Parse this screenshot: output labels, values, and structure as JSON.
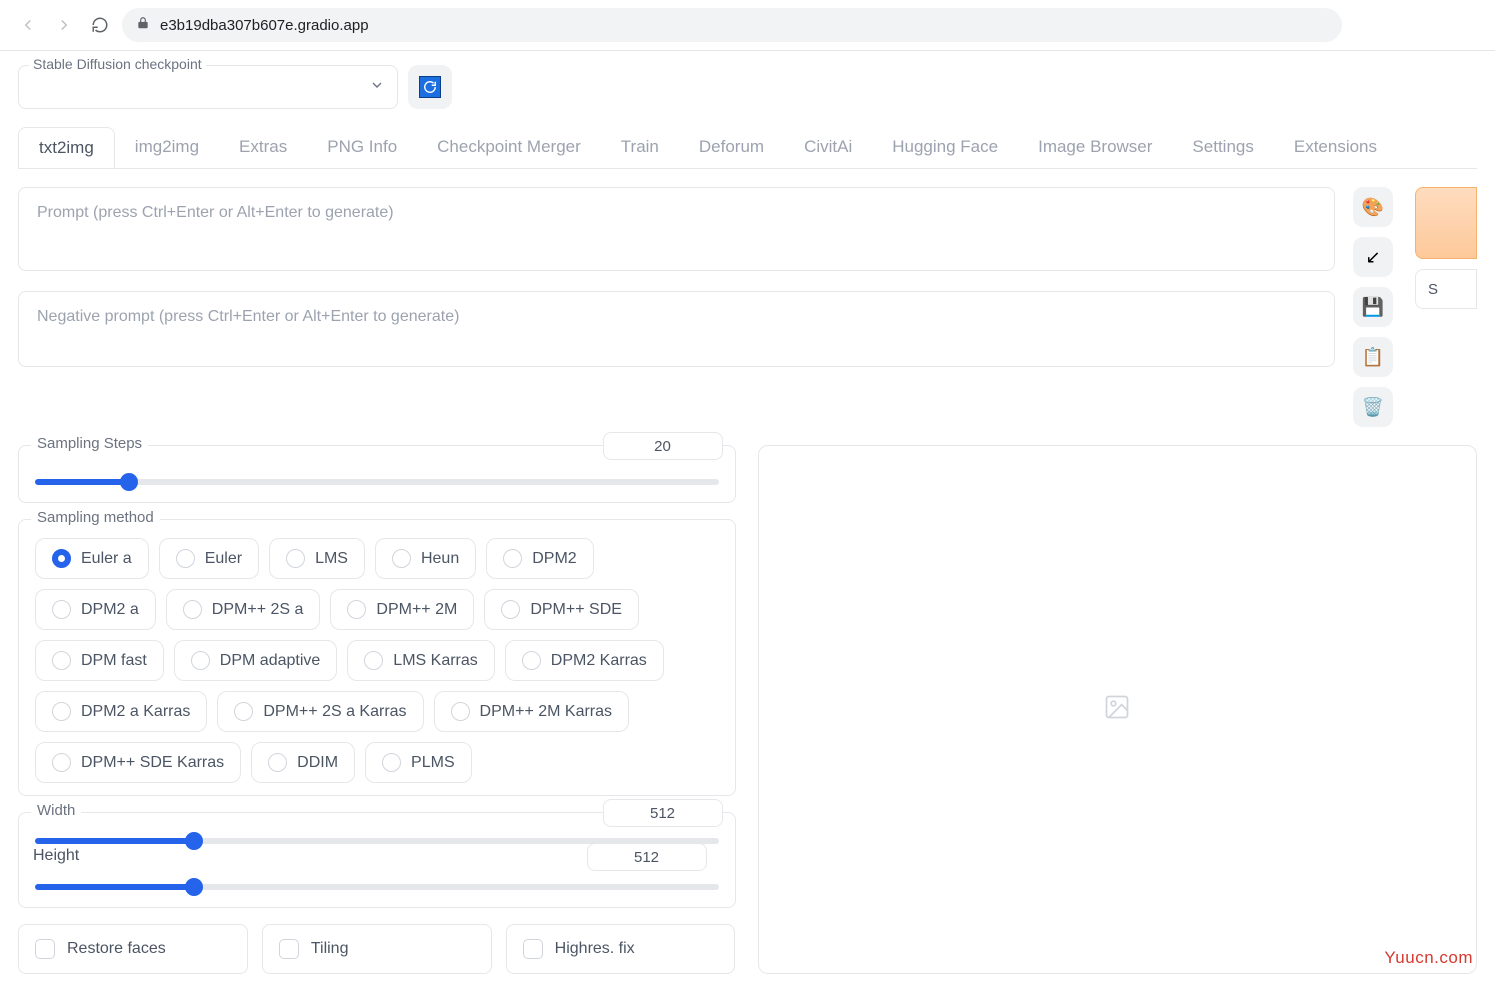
{
  "browser": {
    "url": "e3b19dba307b607e.gradio.app"
  },
  "checkpoint": {
    "label": "Stable Diffusion checkpoint",
    "value": ""
  },
  "tabs": [
    "txt2img",
    "img2img",
    "Extras",
    "PNG Info",
    "Checkpoint Merger",
    "Train",
    "Deforum",
    "CivitAi",
    "Hugging Face",
    "Image Browser",
    "Settings",
    "Extensions"
  ],
  "active_tab": "txt2img",
  "prompt": {
    "value": "",
    "placeholder": "Prompt (press Ctrl+Enter or Alt+Enter to generate)"
  },
  "neg_prompt": {
    "value": "",
    "placeholder": "Negative prompt (press Ctrl+Enter or Alt+Enter to generate)"
  },
  "side_button_char": "S",
  "sampling_steps": {
    "label": "Sampling Steps",
    "value": 20,
    "min": 1,
    "max": 150
  },
  "sampling_method": {
    "label": "Sampling method",
    "selected": "Euler a",
    "options": [
      "Euler a",
      "Euler",
      "LMS",
      "Heun",
      "DPM2",
      "DPM2 a",
      "DPM++ 2S a",
      "DPM++ 2M",
      "DPM++ SDE",
      "DPM fast",
      "DPM adaptive",
      "LMS Karras",
      "DPM2 Karras",
      "DPM2 a Karras",
      "DPM++ 2S a Karras",
      "DPM++ 2M Karras",
      "DPM++ SDE Karras",
      "DDIM",
      "PLMS"
    ]
  },
  "width": {
    "label": "Width",
    "value": 512,
    "min": 64,
    "max": 2048
  },
  "height": {
    "label": "Height",
    "value": 512,
    "min": 64,
    "max": 2048
  },
  "checks": {
    "restore_faces": {
      "label": "Restore faces",
      "checked": false
    },
    "tiling": {
      "label": "Tiling",
      "checked": false
    },
    "highres_fix": {
      "label": "Highres. fix",
      "checked": false
    }
  },
  "watermark": "Yuucn.com"
}
